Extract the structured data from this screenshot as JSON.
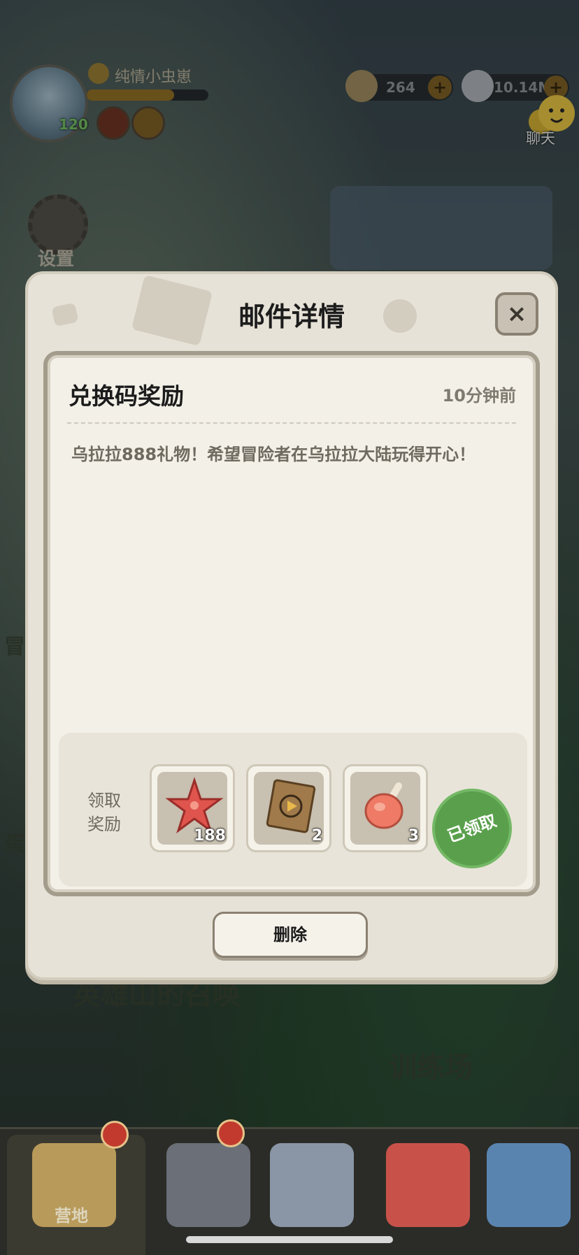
{
  "hud": {
    "player_name": "纯情小虫崽",
    "level": "120",
    "xp_progress": 0.72,
    "resource_1_value": "264",
    "resource_2_value": "10.14M",
    "chat_label": "聊天",
    "settings_label": "设置"
  },
  "background_text": {
    "hero_summon": "英雄山的召唤",
    "training_ground": "训练场",
    "left_text_1": "冒",
    "left_text_2": "蛋"
  },
  "dialog": {
    "title": "邮件详情",
    "close_symbol": "×",
    "mail_title": "兑换码奖励",
    "mail_time": "10分钟前",
    "mail_body": "乌拉拉888礼物！希望冒险者在乌拉拉大陆玩得开心！",
    "reward_label": "领取奖励",
    "rewards": [
      {
        "name": "starfish-icon",
        "count": "188"
      },
      {
        "name": "ticket-icon",
        "count": "2"
      },
      {
        "name": "meat-icon",
        "count": "3"
      }
    ],
    "claimed_stamp": "已领取",
    "delete_label": "删除"
  },
  "nav": {
    "items": [
      {
        "label": "营地",
        "icon": "camp-icon"
      },
      {
        "label": "",
        "icon": "hero-icon"
      },
      {
        "label": "",
        "icon": "equipment-icon"
      },
      {
        "label": "",
        "icon": "pet-icon"
      },
      {
        "label": "",
        "icon": "guild-icon"
      }
    ]
  },
  "colors": {
    "dialog_bg": "#e7e2d7",
    "card_bg": "#f3f0e8",
    "claimed_green": "#5aa04c",
    "nav_bg": "#2b2c27"
  }
}
